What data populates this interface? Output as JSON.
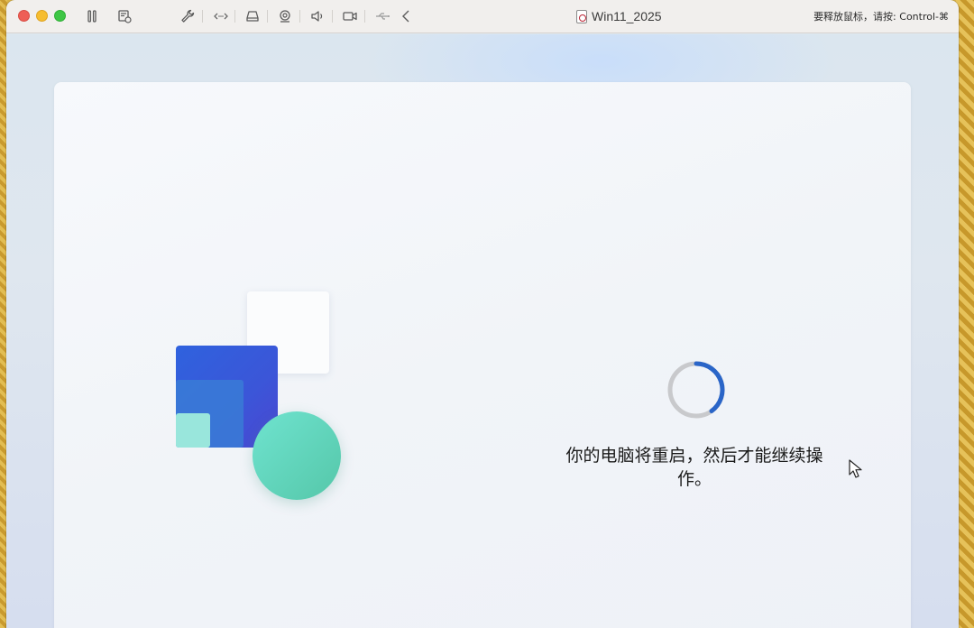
{
  "app": {
    "window_title": "Win11_2025",
    "release_hint": "要释放鼠标，请按: Control-⌘"
  },
  "toolbar": {
    "icons": [
      "pause-icon",
      "snapshot-icon",
      "settings-wrench-icon",
      "network-icon",
      "disk-icon",
      "camera-share-icon",
      "sound-icon",
      "video-camera-icon",
      "usb-icon",
      "back-chevron-icon"
    ]
  },
  "vm_screen": {
    "status_message": "你的电脑将重启，然后才能继续操作。"
  },
  "colors": {
    "spinner_track": "#c8c9cc",
    "spinner_arc": "#2a65c8",
    "titlebar_bg": "#f1efed"
  }
}
